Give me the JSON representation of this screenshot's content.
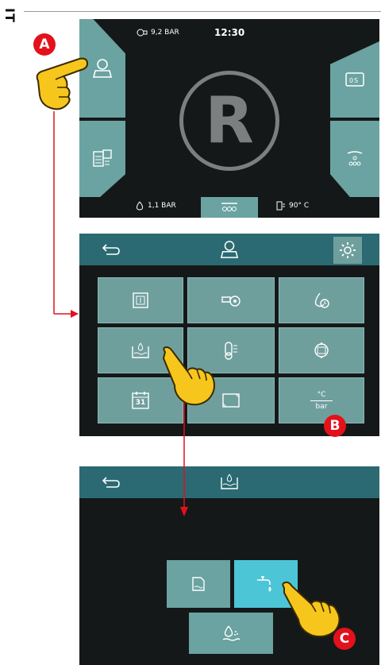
{
  "side_tab": {
    "label": "IT"
  },
  "panel_a": {
    "status": {
      "pressure_top": "9,2 BAR",
      "clock": "12:30",
      "pressure_bottom": "1,1 BAR",
      "temperature": "90° C"
    },
    "logo_letter": "R"
  },
  "panel_b": {
    "header_icons": [
      "back-arrow-icon",
      "user-icon",
      "gear-icon"
    ],
    "grid": [
      "calendar-day-icon",
      "pump-gear-icon",
      "water-timer-icon",
      "tank-level-icon",
      "thermometer-icon",
      "maintenance-icon",
      "calendar-31-icon",
      "frame-icon",
      "units-icon"
    ],
    "calendar_number": "31",
    "units_top": "°C",
    "units_bottom": "bar"
  },
  "panel_c": {
    "header_icons": [
      "back-arrow-icon",
      "tank-level-icon"
    ],
    "options": [
      "tank-icon",
      "tap-icon",
      "water-drop-icon"
    ],
    "active_option": "tap-icon"
  },
  "markers": {
    "a": "A",
    "b": "B",
    "c": "C"
  },
  "colors": {
    "screen_bg": "#151819",
    "tile": "#6aa3a1",
    "active_tile": "#4cc6d6",
    "header": "#2a6a73",
    "marker": "#e3111b",
    "arrow": "#e3111b"
  }
}
